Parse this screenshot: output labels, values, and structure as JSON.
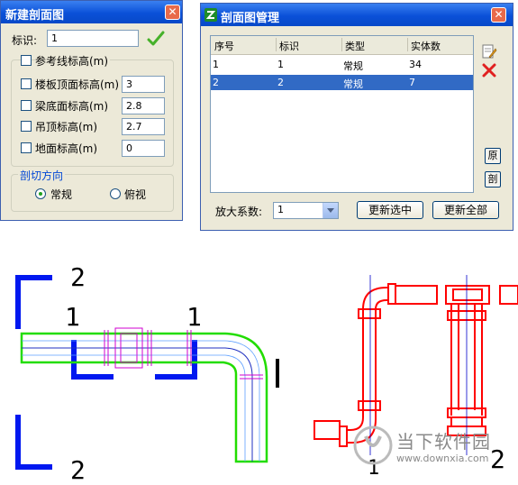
{
  "dialog_new": {
    "title": "新建剖面图",
    "close_glyph": "✕",
    "id_label": "标识:",
    "id_value": "1",
    "ref_line_label": "参考线标高(m)",
    "fields": [
      {
        "label": "楼板顶面标高(m)",
        "value": "3"
      },
      {
        "label": "梁底面标高(m)",
        "value": "2.8"
      },
      {
        "label": "吊顶标高(m)",
        "value": "2.7"
      },
      {
        "label": "地面标高(m)",
        "value": "0"
      }
    ],
    "direction_label": "剖切方向",
    "direction_options": [
      "常规",
      "俯视"
    ],
    "direction_selected": "常规",
    "accent": "#0046d5"
  },
  "dialog_manage": {
    "title": "剖面图管理",
    "close_glyph": "✕",
    "columns": [
      "序号",
      "标识",
      "类型",
      "实体数"
    ],
    "rows": [
      [
        "1",
        "1",
        "常规",
        "34"
      ],
      [
        "2",
        "2",
        "常规",
        "7"
      ]
    ],
    "selected_row": 1,
    "side_buttons": [
      "原",
      "剖"
    ],
    "zoom_label": "放大系数:",
    "zoom_value": "1",
    "update_selected_label": "更新选中",
    "update_all_label": "更新全部",
    "icons": [
      "edit-icon",
      "delete-icon"
    ]
  },
  "drawing": {
    "section_labels": [
      "1",
      "1",
      "2",
      "2"
    ],
    "result_labels": [
      "1",
      "2"
    ],
    "colors": {
      "marker": "#0018f0",
      "pipe": "#22dd00",
      "result": "#ff0000",
      "axis": "#0000cc"
    }
  },
  "watermark": {
    "brand": "当下软件园",
    "url": "www.downxia.com"
  }
}
